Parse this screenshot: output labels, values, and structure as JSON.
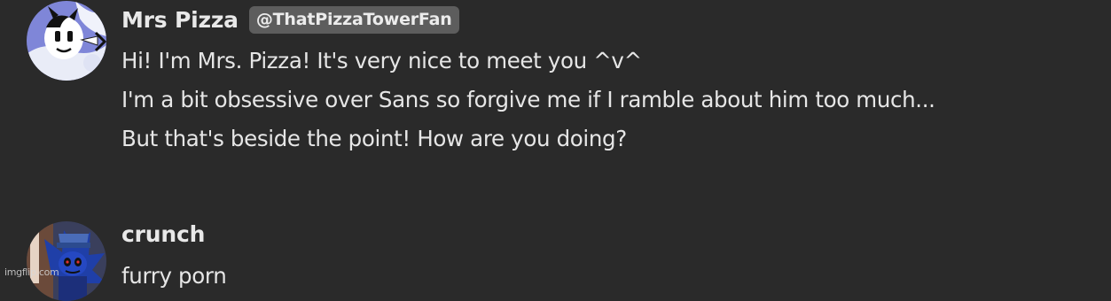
{
  "messages": [
    {
      "author": "Mrs Pizza",
      "handle": "@ThatPizzaTowerFan",
      "avatar_icon": "cartoon-character-avatar-icon",
      "lines": [
        "Hi! I'm Mrs. Pizza! It's very nice to meet you ^v^",
        "I'm a bit obsessive over Sans so forgive me if I ramble about him too much...",
        "But that's beside the point! How are you doing?"
      ]
    },
    {
      "author": "crunch",
      "avatar_icon": "blue-hedgehog-avatar-icon",
      "lines": [
        "furry porn"
      ]
    }
  ],
  "watermark": "imgflip.com",
  "colors": {
    "background": "#2a2a2a",
    "text": "#e6e6e6",
    "badge_background": "#5d5d5d"
  }
}
